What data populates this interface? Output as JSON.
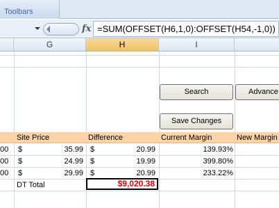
{
  "ribbon": {
    "group_label": "Toolbars"
  },
  "formula_bar": {
    "fx_label": "fx",
    "formula": "=SUM(OFFSET(H6,1,0):OFFSET(H54,-1,0))"
  },
  "columns": [
    "G",
    "H",
    "I"
  ],
  "buttons": {
    "search": "Search",
    "advanced": "Advance",
    "save_changes": "Save Changes"
  },
  "table": {
    "headers": {
      "site_price": "Site Price",
      "difference": "Difference",
      "current_margin": "Current Margin",
      "new_margin": "New Margin"
    },
    "rows": [
      {
        "f_partial": "00",
        "currency_g": "$",
        "site_price": "35.99",
        "currency_h": "$",
        "difference": "20.99",
        "current_margin": "139.93%"
      },
      {
        "f_partial": "00",
        "currency_g": "$",
        "site_price": "24.99",
        "currency_h": "$",
        "difference": "19.99",
        "current_margin": "399.80%"
      },
      {
        "f_partial": "00",
        "currency_g": "$",
        "site_price": "29.99",
        "currency_h": "$",
        "difference": "20.99",
        "current_margin": "233.22%"
      }
    ],
    "total_label": "DT Total",
    "total_value": "$9,020.38"
  },
  "colors": {
    "header_fill": "#fbd3a9",
    "selected_col": "#f1c15f",
    "total_text": "#e00000"
  }
}
